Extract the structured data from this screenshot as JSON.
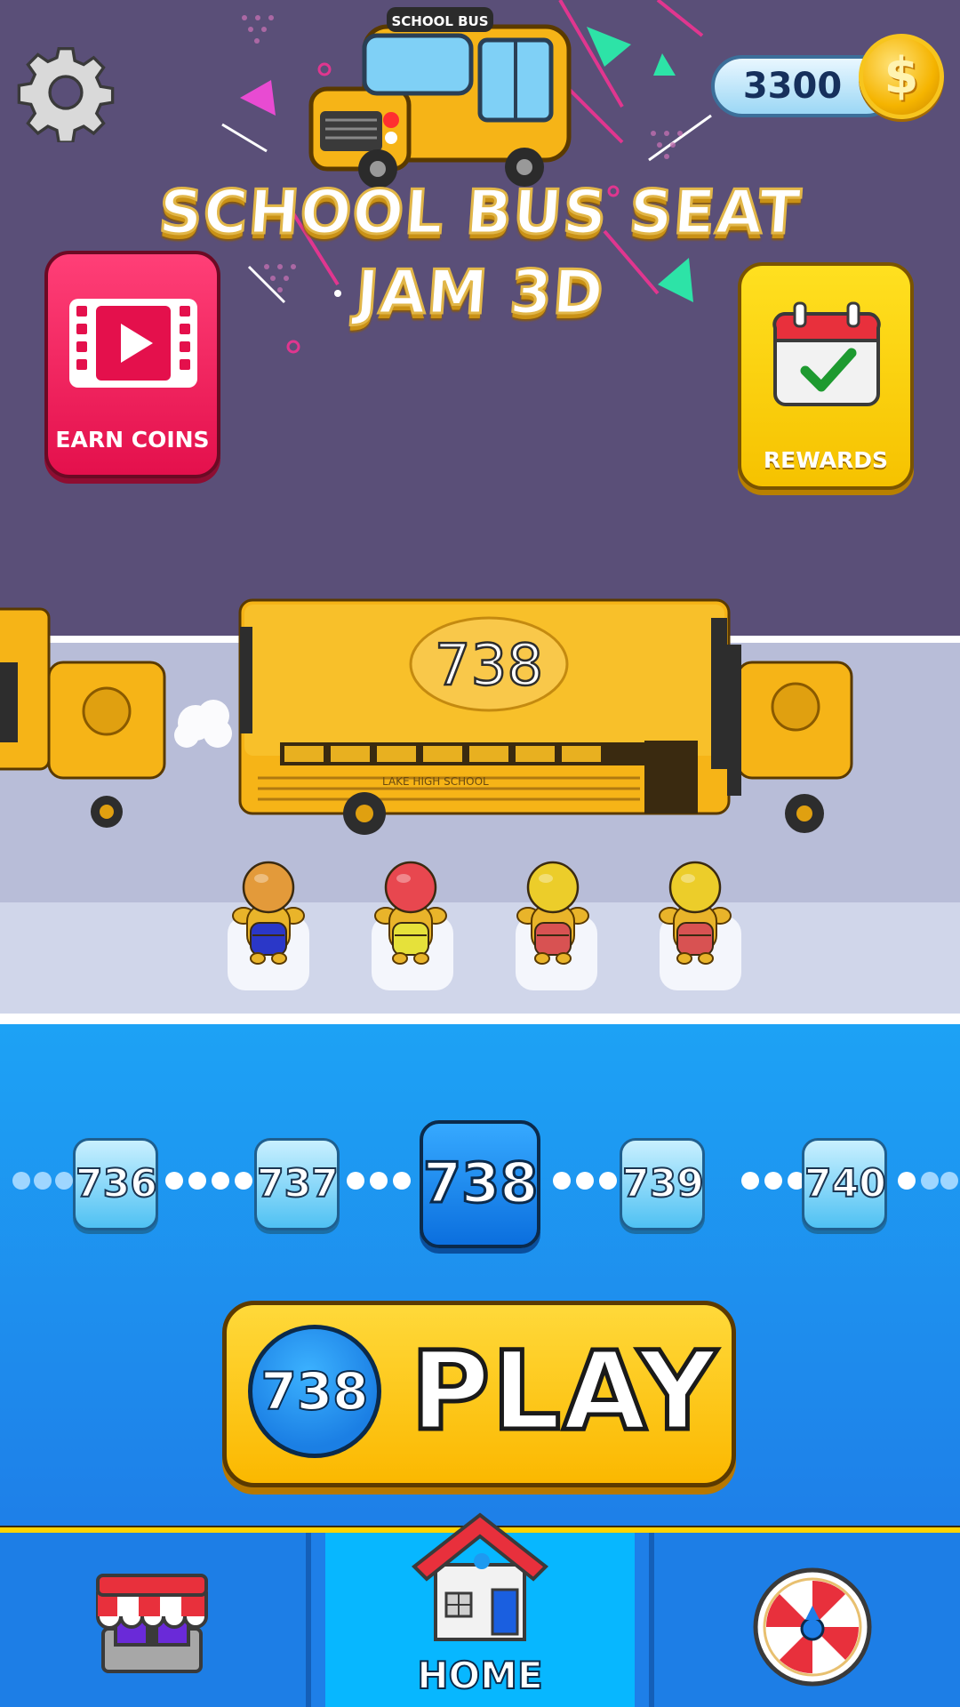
{
  "header": {
    "coins": "3300",
    "coin_symbol": "$",
    "title_line1": "SCHOOL BUS SEAT",
    "title_line2": "JAM 3D",
    "logo_bus_sign": "SCHOOL BUS"
  },
  "actions": {
    "earn_coins_label": "EARN COINS",
    "rewards_label": "REWARDS"
  },
  "scene": {
    "bus_number": "738",
    "bus_side_text": "LAKE HIGH SCHOOL"
  },
  "passengers": [
    {
      "head": "#e39a3a",
      "pack": "#2a37c8"
    },
    {
      "head": "#e8474f",
      "pack": "#e6e13a"
    },
    {
      "head": "#eccd2a",
      "pack": "#d85252"
    },
    {
      "head": "#eccd2a",
      "pack": "#d85252"
    }
  ],
  "levels": {
    "items": [
      "736",
      "737",
      "738",
      "739",
      "740"
    ],
    "current": "738"
  },
  "play": {
    "level": "738",
    "label": "PLAY"
  },
  "nav": {
    "shop_label": "",
    "home_label": "HOME",
    "spin_label": ""
  },
  "colors": {
    "top_bg": "#5a4f78",
    "accent_blue": "#1e7fe8",
    "bus_yellow": "#f6b417",
    "earn_red": "#e4104c",
    "rewards_yellow": "#f6c200"
  }
}
